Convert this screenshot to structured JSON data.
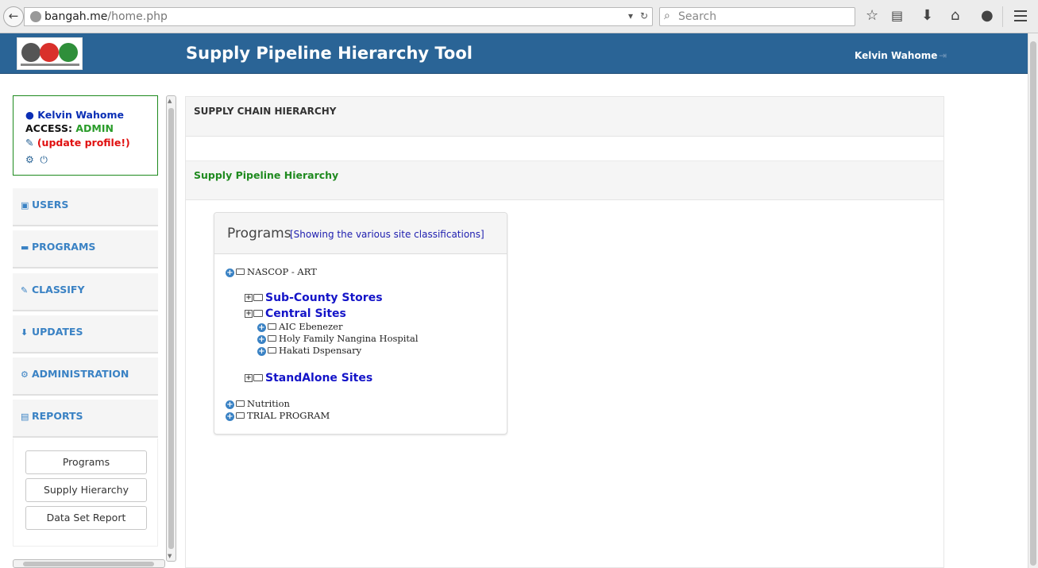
{
  "browser": {
    "url_host": "bangah.me",
    "url_path": "/home.php",
    "search_placeholder": "Search"
  },
  "header": {
    "title": "Supply Pipeline Hierarchy Tool",
    "user": "Kelvin Wahome"
  },
  "profile": {
    "name": "Kelvin Wahome",
    "access_label": "ACCESS:",
    "access_value": "ADMIN",
    "update_link": "(update profile!)"
  },
  "sidebar": {
    "items": [
      {
        "label": "USERS",
        "icon": "users-icon"
      },
      {
        "label": "PROGRAMS",
        "icon": "briefcase-icon"
      },
      {
        "label": "CLASSIFY",
        "icon": "edit-icon"
      },
      {
        "label": "UPDATES",
        "icon": "download-icon"
      },
      {
        "label": "ADMINISTRATION",
        "icon": "cogs-icon"
      },
      {
        "label": "REPORTS",
        "icon": "report-icon"
      }
    ],
    "reports_sub": [
      "Programs",
      "Supply Hierarchy",
      "Data Set Report"
    ]
  },
  "main": {
    "section_title": "SUPPLY CHAIN HIERARCHY",
    "subsection_title": "Supply Pipeline Hierarchy",
    "programs_title": "Programs",
    "programs_subtitle": "[Showing the various site classifications]",
    "tree": {
      "root": "NASCOP - ART",
      "groups": [
        "Sub-County Stores",
        "Central Sites",
        "StandAlone Sites"
      ],
      "central_sites": [
        "AIC Ebenezer",
        "Holy Family Nangina Hospital",
        "Hakati Dspensary"
      ],
      "other_programs": [
        "Nutrition",
        "TRIAL PROGRAM"
      ]
    }
  },
  "colors": {
    "header_bg": "#2a6496",
    "accent": "#3a82c4",
    "admin_green": "#2a9c2a",
    "alert_red": "#e01010"
  }
}
